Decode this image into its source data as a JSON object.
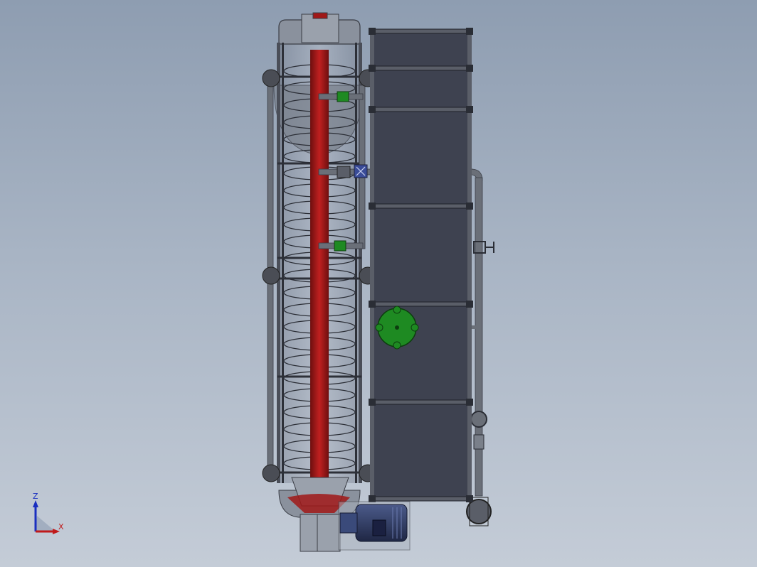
{
  "viewport": {
    "background_top": "#8e9db1",
    "background_bottom": "#c4ccd7"
  },
  "model": {
    "colors": {
      "shaft": "#a01818",
      "tank_panel": "#3e4250",
      "frame": "#2a2d35",
      "pipe": "#6a6f78",
      "valve_green": "#1e8a22",
      "motor": "#2f3a5e",
      "flange": "#4a4d55"
    }
  },
  "triad": {
    "z_label": "Z",
    "x_label": "X",
    "z_color": "#1a2fc0",
    "x_color": "#c01a1a"
  }
}
